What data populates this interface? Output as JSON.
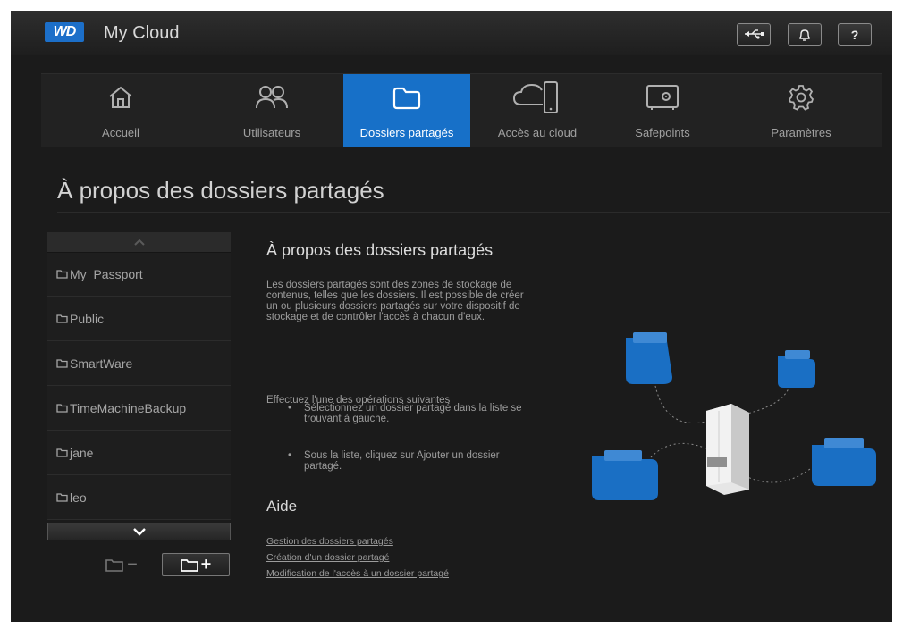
{
  "header": {
    "logo_text": "WD",
    "app_title": "My Cloud",
    "usb_icon": "usb-icon",
    "bell_icon": "bell-icon",
    "help_label": "?"
  },
  "nav": {
    "items": [
      {
        "label": "Accueil",
        "icon": "home-icon"
      },
      {
        "label": "Utilisateurs",
        "icon": "users-icon"
      },
      {
        "label": "Dossiers partagés",
        "icon": "folder-icon",
        "active": true
      },
      {
        "label": "Accès au cloud",
        "icon": "cloud-device-icon"
      },
      {
        "label": "Safepoints",
        "icon": "safe-icon"
      },
      {
        "label": "Paramètres",
        "icon": "gear-icon"
      }
    ]
  },
  "page": {
    "title": "À propos des dossiers partagés"
  },
  "sidebar": {
    "folders": [
      "My_Passport",
      "Public",
      "SmartWare",
      "TimeMachineBackup",
      "jane",
      "leo"
    ],
    "delete_label": "−",
    "add_label": "+"
  },
  "content": {
    "title": "À propos des dossiers partagés",
    "paragraph": "Les dossiers partagés sont des zones de stockage de contenus, telles que les dossiers. Il est possible de créer un ou plusieurs dossiers partagés sur votre dispositif de stockage et de contrôler l'accès à chacun d'eux.",
    "intro": "Effectuez l'une des opérations suivantes",
    "bullets": [
      "Sélectionnez un dossier partagé dans la liste se trouvant à gauche.",
      "Sous la liste, cliquez sur Ajouter un dossier partagé."
    ],
    "help_title": "Aide",
    "help_links": [
      "Gestion des dossiers partagés",
      "Création d'un dossier partagé",
      "Modification de l'accès à un dossier partagé"
    ]
  },
  "colors": {
    "accent": "#1770c8",
    "background": "#1b1b1b",
    "folder_blue": "#1a6fc4"
  }
}
